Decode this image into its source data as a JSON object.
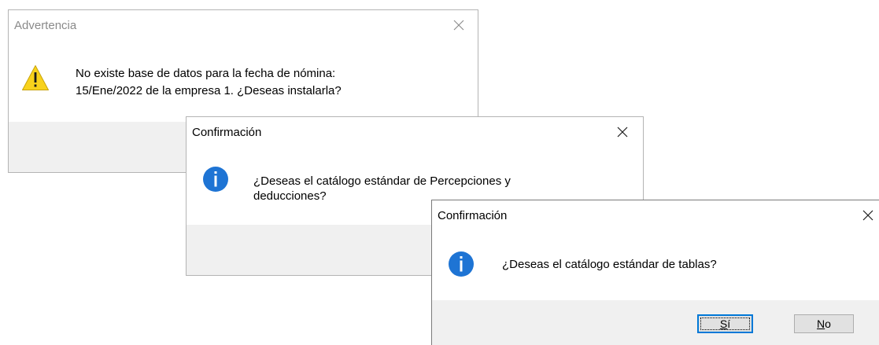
{
  "warning_dialog": {
    "title": "Advertencia",
    "icon": "warning-icon",
    "message_line1": "No existe base de datos para la fecha de nómina:",
    "message_line2": " 15/Ene/2022 de la empresa  1. ¿Deseas instalarla?"
  },
  "confirm_dialog_1": {
    "title": "Confirmación",
    "icon": "info-icon",
    "message_line1": "¿Deseas el catálogo estándar de Percepciones y",
    "message_line2": "deducciones?"
  },
  "confirm_dialog_2": {
    "title": "Confirmación",
    "icon": "info-icon",
    "message": "¿Deseas el catálogo estándar de tablas?",
    "yes_button": {
      "mnemonic": "S",
      "rest": "í"
    },
    "no_button": {
      "mnemonic": "N",
      "rest": "o"
    }
  },
  "colors": {
    "warning_yellow": "#f8d21c",
    "info_blue": "#1e74d4",
    "footer_gray": "#f0f0f0",
    "accent_blue": "#0078d7"
  }
}
